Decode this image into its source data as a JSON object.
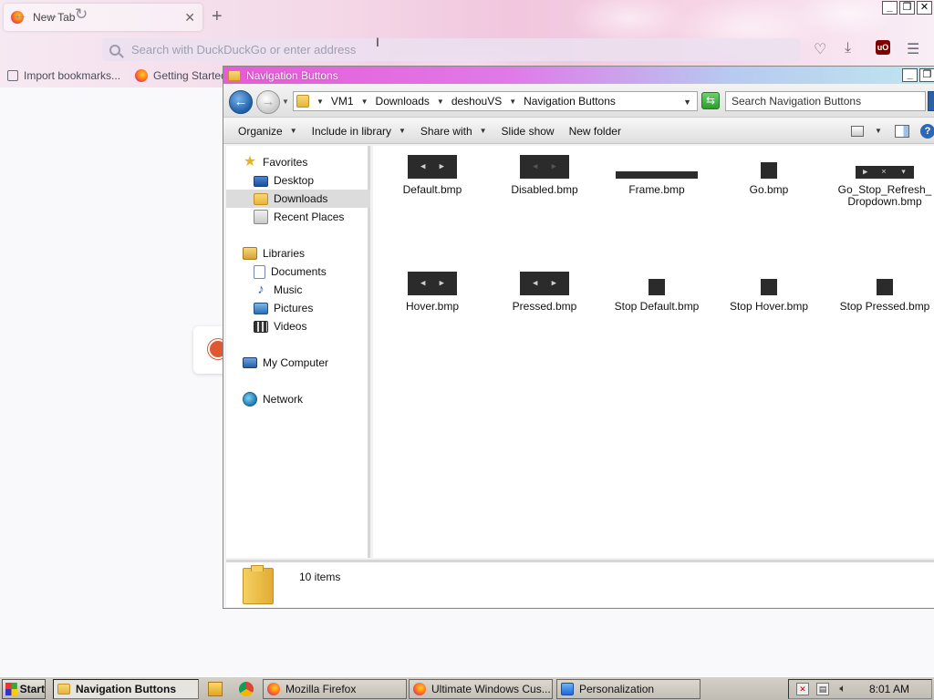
{
  "firefox": {
    "tab_title": "New Tab",
    "url_placeholder": "Search with DuckDuckGo or enter address",
    "bookmarks": [
      "Import bookmarks...",
      "Getting Started"
    ]
  },
  "explorer": {
    "title": "Navigation Buttons",
    "breadcrumb": [
      "VM1",
      "Downloads",
      "deshouVS",
      "Navigation Buttons"
    ],
    "search_placeholder": "Search Navigation Buttons",
    "commands": [
      "Organize",
      "Include in library",
      "Share with",
      "Slide show",
      "New folder"
    ],
    "nav": {
      "favorites": "Favorites",
      "desktop": "Desktop",
      "downloads": "Downloads",
      "recent_places": "Recent Places",
      "libraries": "Libraries",
      "documents": "Documents",
      "music": "Music",
      "pictures": "Pictures",
      "videos": "Videos",
      "my_computer": "My Computer",
      "network": "Network"
    },
    "files": [
      "Default.bmp",
      "Disabled.bmp",
      "Frame.bmp",
      "Go.bmp",
      "Go_Stop_Refresh_\nDropdown.bmp",
      "Hover.bmp",
      "Pressed.bmp",
      "Stop Default.bmp",
      "Stop Hover.bmp",
      "Stop Pressed.bmp"
    ],
    "status": "10 items"
  },
  "taskbar": {
    "start": "Start",
    "tasks": [
      "Navigation Buttons",
      "Mozilla Firefox",
      "Ultimate Windows Cus...",
      "Personalization"
    ],
    "clock": "8:01 AM"
  }
}
